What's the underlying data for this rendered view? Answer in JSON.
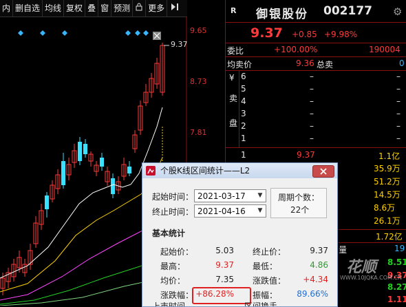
{
  "toolbar": {
    "items": [
      "内",
      "删自选",
      "均线",
      "复权",
      "叠",
      "窗",
      "预测",
      "更多"
    ],
    "lock_icon": "lock-icon",
    "pin_icon": "pin-icon"
  },
  "chart": {
    "price_labels": [
      "9.65",
      "8.73",
      "7.81"
    ],
    "current_price_tag": "9.37",
    "close_icon": "close-icon",
    "colors": {
      "up": "#ff3a3a",
      "down": "#39e0ff",
      "ma1": "#ffffff",
      "ma2": "#ffd200",
      "ma3": "#ff44ff",
      "ma4": "#22d022"
    }
  },
  "quote": {
    "stock_name": "御银股份",
    "stock_code": "002177",
    "market_badge": "R",
    "settings_icon": "gear-icon",
    "price": "9.37",
    "change": "+0.85",
    "change_pct": "+9.98%",
    "webi_label": "委比",
    "webi_value": "+100.00%",
    "webi_diff": "190004",
    "avg_label": "均卖价",
    "avg_value": "9.36",
    "total_sell_label": "总卖",
    "total_sell_value": "0",
    "sell_side_label": [
      "¥",
      "卖",
      "盘"
    ],
    "sell_levels": [
      {
        "lvl": "6",
        "price": "–",
        "vol": "–"
      },
      {
        "lvl": "5",
        "price": "–",
        "vol": "–"
      },
      {
        "lvl": "4",
        "price": "–",
        "vol": "–"
      },
      {
        "lvl": "3",
        "price": "–",
        "vol": "–"
      },
      {
        "lvl": "2",
        "price": "–",
        "vol": "–"
      },
      {
        "lvl": "1",
        "price": "–",
        "vol": "–"
      }
    ],
    "buy_first": {
      "lvl": "1",
      "price": "9.37",
      "vol": "1.1亿"
    },
    "buy_vols": [
      "35.9万",
      "51.2万",
      "14.5万",
      "8.6万",
      "26.1万"
    ],
    "bottom_values": [
      "1.72亿",
      "19",
      "8.51",
      "9.37",
      "8.27",
      "1.11"
    ],
    "bottom_label": "量"
  },
  "dialog": {
    "title": "个股K线区间统计——L2",
    "start_label": "起始时间：",
    "start_value": "2021-03-17",
    "end_label": "终止时间：",
    "end_value": "2021-04-16",
    "period_label": "周期个数：",
    "period_value": "22个",
    "section_title": "基本统计",
    "rows": [
      {
        "l1": "起始价：",
        "v1": "5.03",
        "l2": "终止价：",
        "v2": "9.37"
      },
      {
        "l1": "最高：",
        "v1": "9.37",
        "l2": "最低：",
        "v2": "4.86"
      },
      {
        "l1": "均价：",
        "v1": "7.35",
        "l2": "涨跌值：",
        "v2": "+4.34"
      },
      {
        "l1": "涨跌幅：",
        "v1": "+86.28%",
        "l2": "振幅：",
        "v2": "89.66%"
      }
    ],
    "partial_labels": [
      "上市时间",
      "区间换手"
    ]
  },
  "watermark": {
    "brand": "花顺",
    "url": "WWW.10JQKA.COM.CN"
  }
}
